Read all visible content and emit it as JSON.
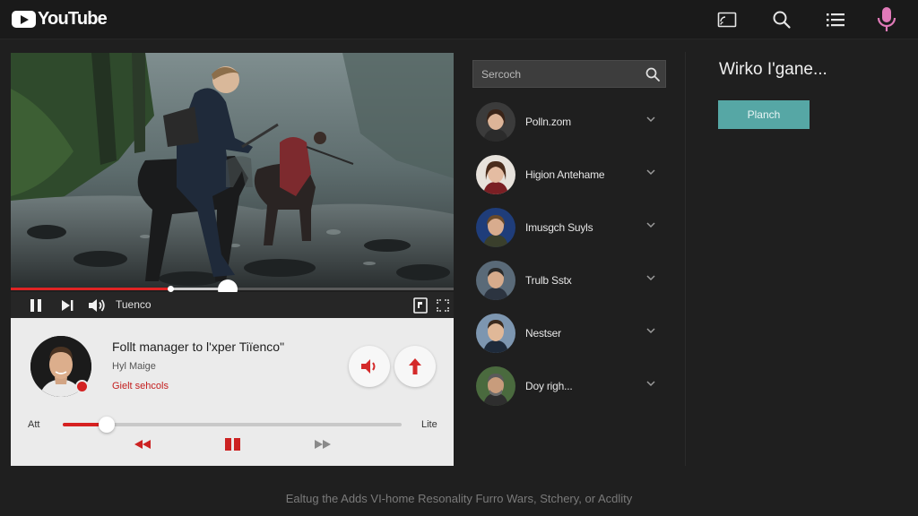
{
  "header": {
    "logo_text": "YouTube",
    "icons": [
      "cast-icon",
      "search-icon",
      "menu-icon",
      "microphone-icon"
    ]
  },
  "player": {
    "played_fraction": 0.36,
    "buffered_fraction": 0.49,
    "control_label": "Tuenco"
  },
  "info_card": {
    "title": "Follt manager to l'xper Tiïenco\"",
    "subtitle": "Hyl Maige",
    "link": "Gielt sehcols",
    "seek_left_label": "Att",
    "seek_right_label": "Lite",
    "seek_fraction": 0.13
  },
  "search": {
    "placeholder": "Sercoch"
  },
  "channels": [
    {
      "name": "Polln.zom"
    },
    {
      "name": "Higion Antehame"
    },
    {
      "name": "Imusgch Suyls"
    },
    {
      "name": "Trulb Sstx"
    },
    {
      "name": "Nestser"
    },
    {
      "name": "Doy righ..."
    }
  ],
  "side": {
    "title": "Wirko I'gane...",
    "button_label": "Planch"
  },
  "footer": {
    "text": "Ealtug the Adds VI-home Resonality Furro Wars, Stchery, or Acdlity"
  },
  "colors": {
    "accent_red": "#e02424",
    "teal_button": "#56a7a5",
    "mic_pink": "#e07ab8"
  }
}
